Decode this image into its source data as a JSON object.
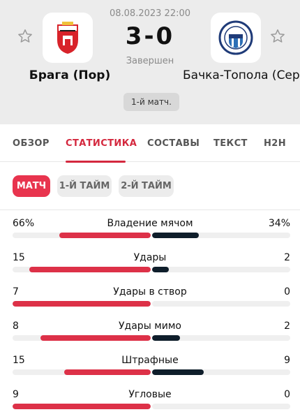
{
  "match": {
    "datetime": "08.08.2023 22:00",
    "score": "3-0",
    "status": "Завершен",
    "badge": "1-й матч.",
    "home_team": "Брага (Пор)",
    "away_team": "Бачка-Топола (Сер)"
  },
  "tabs": [
    {
      "label": "ОБЗОР",
      "active": false
    },
    {
      "label": "СТАТИСТИКА",
      "active": true
    },
    {
      "label": "СОСТАВЫ",
      "active": false
    },
    {
      "label": "ТЕКСТ",
      "active": false
    },
    {
      "label": "H2H",
      "active": false
    }
  ],
  "period_filters": [
    {
      "label": "МАТЧ",
      "active": true
    },
    {
      "label": "1-Й ТАЙМ",
      "active": false
    },
    {
      "label": "2-Й ТАЙМ",
      "active": false
    }
  ],
  "stats": [
    {
      "label": "Владение мячом",
      "home": "66%",
      "away": "34%",
      "home_share": 0.66,
      "away_share": 0.34
    },
    {
      "label": "Удары",
      "home": "15",
      "away": "2",
      "home_share": 0.88,
      "away_share": 0.12
    },
    {
      "label": "Удары в створ",
      "home": "7",
      "away": "0",
      "home_share": 1.0,
      "away_share": 0.0
    },
    {
      "label": "Удары мимо",
      "home": "8",
      "away": "2",
      "home_share": 0.8,
      "away_share": 0.2
    },
    {
      "label": "Штрафные",
      "home": "15",
      "away": "9",
      "home_share": 0.625,
      "away_share": 0.375
    },
    {
      "label": "Угловые",
      "home": "9",
      "away": "0",
      "home_share": 1.0,
      "away_share": 0.0
    }
  ],
  "colors": {
    "accent": "#e8344e",
    "home_bar": "#dd3148",
    "away_bar": "#0f1e2b",
    "header_bg": "#ececec"
  },
  "icons": {
    "favorite_left": "star-outline-icon",
    "favorite_right": "star-outline-icon",
    "home_logo": "braga-crest-icon",
    "away_logo": "tsc-crest-icon"
  }
}
